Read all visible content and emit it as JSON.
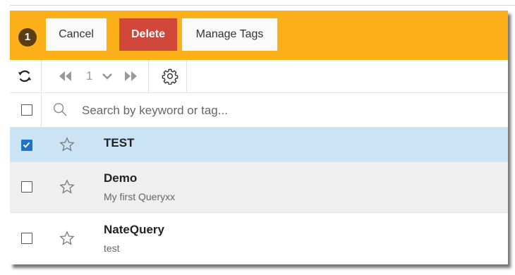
{
  "toolbar": {
    "selected_count": "1",
    "cancel_label": "Cancel",
    "delete_label": "Delete",
    "manage_tags_label": "Manage Tags"
  },
  "pager": {
    "page": "1",
    "icons": [
      "refresh-icon",
      "first-page-icon",
      "chevron-down-icon",
      "last-page-icon",
      "gear-icon"
    ]
  },
  "search": {
    "placeholder": "Search by keyword or tag...",
    "value": ""
  },
  "items": [
    {
      "title": "TEST",
      "subtitle": "",
      "checked": true
    },
    {
      "title": "Demo",
      "subtitle": "My first Queryxx",
      "checked": false
    },
    {
      "title": "NateQuery",
      "subtitle": "test",
      "checked": false
    }
  ],
  "colors": {
    "toolbar_bg": "#fbb019",
    "delete_bg": "#d0473a",
    "selected_row_bg": "#cbe4f5",
    "alt_row_bg": "#efefef",
    "checkbox_checked": "#1f73c8"
  }
}
